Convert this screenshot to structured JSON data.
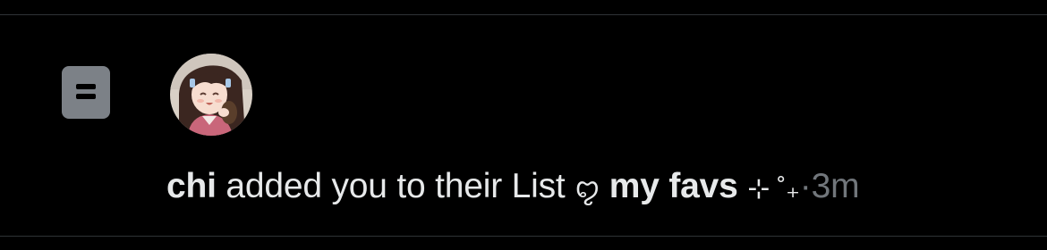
{
  "notification": {
    "user_name": "chi",
    "action_text": "added you to their List",
    "list_prefix": "ꨄ",
    "list_name": "my favs",
    "list_suffix": "⊹ ˚₊",
    "separator": "·",
    "timestamp": "3m",
    "icon": "list-icon",
    "avatar": "user-avatar"
  },
  "colors": {
    "background": "#000000",
    "divider": "#2f3336",
    "primary_text": "#e7e9ea",
    "secondary_text": "#71767b",
    "list_icon_bg": "#7c8187"
  }
}
